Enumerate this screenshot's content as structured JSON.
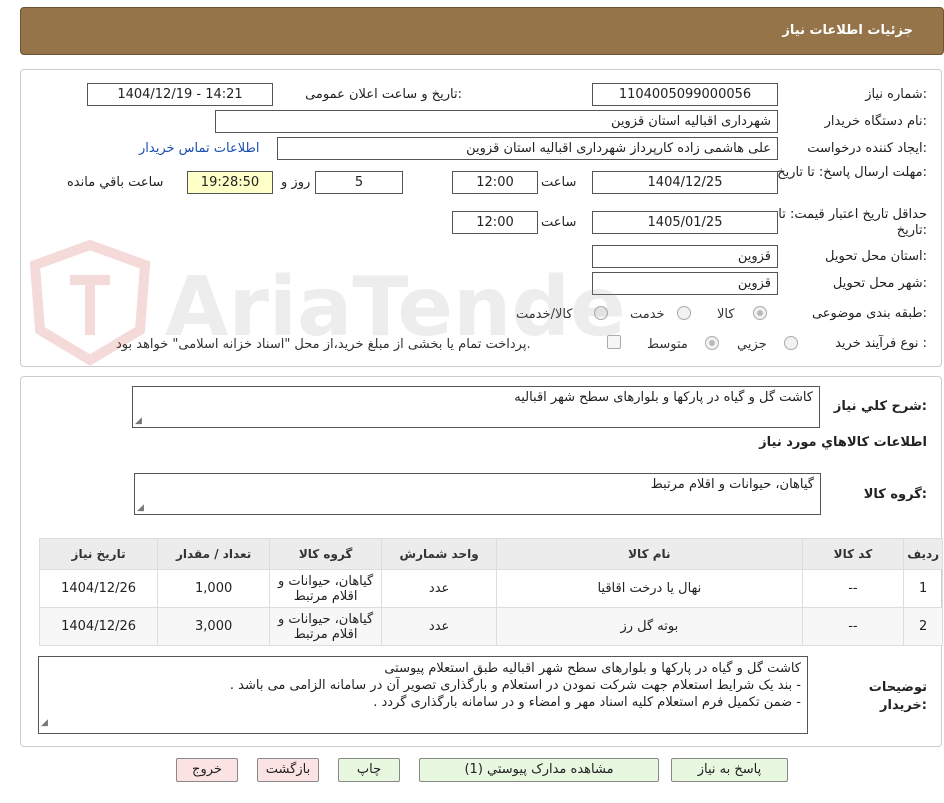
{
  "header": {
    "title": "جزئیات اطلاعات نیاز"
  },
  "form": {
    "need_number_label": "شماره نیاز:",
    "need_number": "1104005099000056",
    "announce_label": "تاریخ و ساعت اعلان عمومی:",
    "announce_value": "1404/12/19 - 14:21",
    "buyer_org_label": "نام دستگاه خریدار:",
    "buyer_org": "شهرداری اقبالیه استان قزوین",
    "creator_label": "ایجاد کننده درخواست:",
    "creator": "علی هاشمی زاده کارپرداز شهرداری اقبالیه استان قزوین",
    "contact_link": "اطلاعات تماس خریدار",
    "deadline_label": "مهلت ارسال پاسخ: تا تاریخ:",
    "deadline_date": "1404/12/25",
    "time_label": "ساعت",
    "deadline_time": "12:00",
    "days": "5",
    "days_label": "روز و",
    "remaining_time": "19:28:50",
    "remaining_label": "ساعت باقي مانده",
    "validity_label": "حداقل تاریخ اعتبار قیمت: تا تاریخ:",
    "validity_date": "1405/01/25",
    "validity_time": "12:00",
    "province_label": "استان محل تحویل:",
    "province": "قزوین",
    "city_label": "شهر محل تحویل:",
    "city": "قزوین",
    "category_label": "طبقه بندی موضوعی:",
    "category_options": [
      "کالا",
      "خدمت",
      "کالا/خدمت"
    ],
    "purchase_type_label": "نوع فرآیند خرید :",
    "purchase_options": [
      "جزیي",
      "متوسط"
    ],
    "payment_note": "پرداخت تمام یا بخشی از مبلغ خرید،از محل \"اسناد خزانه اسلامی\" خواهد بود."
  },
  "watermark": {
    "text": "AriaTender.neT"
  },
  "summary": {
    "general_desc_label": "شرح كلي نیاز:",
    "general_desc": "کاشت گل و گیاه در پارکها و بلوارهای سطح شهر اقبالیه",
    "goods_info_title": "اطلاعات كالاهاي مورد نیاز",
    "goods_group_label": "گروه كالا:",
    "goods_group": "گیاهان، حیوانات و اقلام مرتبط"
  },
  "table": {
    "headers": [
      "ردیف",
      "کد کالا",
      "نام کالا",
      "واحد شمارش",
      "گروه کالا",
      "تعداد / مقدار",
      "تاریخ نیاز"
    ],
    "rows": [
      [
        "1",
        "--",
        "نهال یا درخت اقاقیا",
        "عدد",
        "گیاهان، حیوانات و اقلام مرتبط",
        "1,000",
        "1404/12/26"
      ],
      [
        "2",
        "--",
        "بوته گل رز",
        "عدد",
        "گیاهان، حیوانات و اقلام مرتبط",
        "3,000",
        "1404/12/26"
      ]
    ]
  },
  "buyer_notes": {
    "label": "توضیحات خریدار:",
    "lines": [
      "کاشت گل و گیاه در پارکها و بلوارهای سطح شهر اقبالیه طبق استعلام پیوستی",
      "- بند یک شرایط استعلام جهت شرکت نمودن در استعلام و بارگذاری تصویر آن در سامانه الزامی می باشد .",
      "- ضمن تکمیل فرم استعلام کلیه اسناد مهر و امضاء و در سامانه بارگذاری گردد ."
    ]
  },
  "buttons": {
    "respond": "پاسخ به نیاز",
    "attachments": "مشاهده مدارک پیوستي (1)",
    "print": "چاپ",
    "back": "بازگشت",
    "exit": "خروج"
  }
}
